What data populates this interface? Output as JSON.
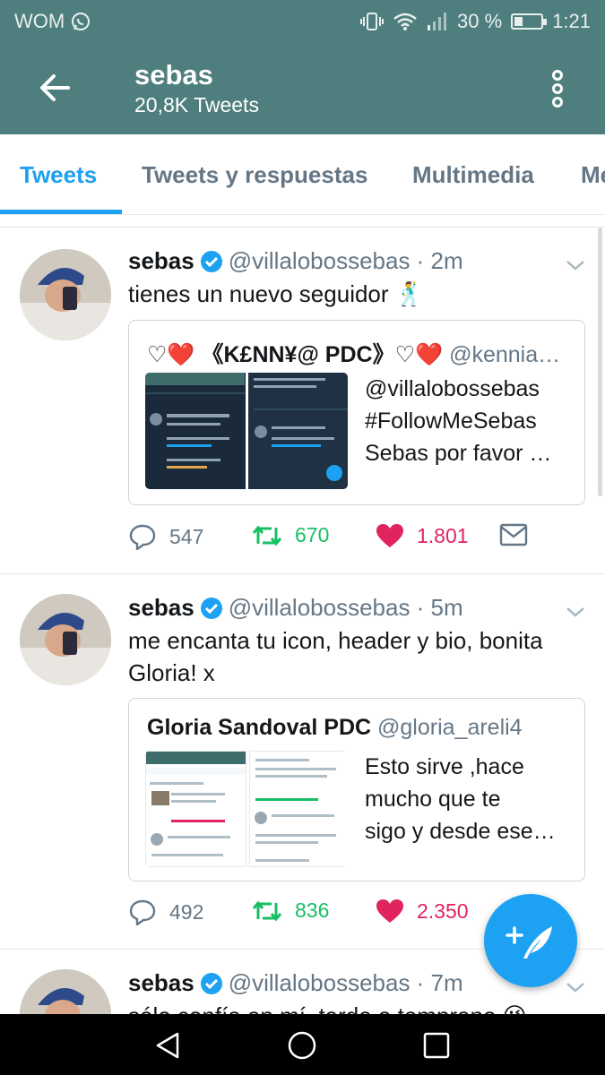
{
  "status_bar": {
    "carrier": "WOM",
    "battery": "30 %",
    "time": "1:21"
  },
  "app_bar": {
    "title": "sebas",
    "subtitle": "20,8K Tweets"
  },
  "tabs": [
    {
      "label": "Tweets",
      "active": true
    },
    {
      "label": "Tweets y respuestas",
      "active": false
    },
    {
      "label": "Multimedia",
      "active": false
    },
    {
      "label": "Me",
      "active": false
    }
  ],
  "tweets": [
    {
      "name": "sebas",
      "handle": "@villalobossebas · 2m",
      "text": "tienes un nuevo seguidor 🕺",
      "quote": {
        "name": "♡❤️ 《K£NN¥@ PDC》♡❤️",
        "handle": "@kennia…",
        "text": "@villalobossebas\n#FollowMeSebas\nSebas por favor …"
      },
      "replies": "547",
      "retweets": "670",
      "likes": "1.801"
    },
    {
      "name": "sebas",
      "handle": "@villalobossebas · 5m",
      "text": "me encanta tu icon, header y bio, bonita Gloria! x",
      "quote": {
        "name": "Gloria Sandoval PDC",
        "handle": "@gloria_areli4",
        "text": "Esto sirve ,hace\nmucho que te\nsigo y desde ese…"
      },
      "replies": "492",
      "retweets": "836",
      "likes": "2.350"
    },
    {
      "name": "sebas",
      "handle": "@villalobossebas · 7m",
      "text": "sólo confía en mí, tarde o temprano 😉"
    }
  ],
  "colors": {
    "header": "#4e7e7d",
    "accent": "#1da1f2",
    "retweet": "#17bf63",
    "like": "#e0245e"
  }
}
